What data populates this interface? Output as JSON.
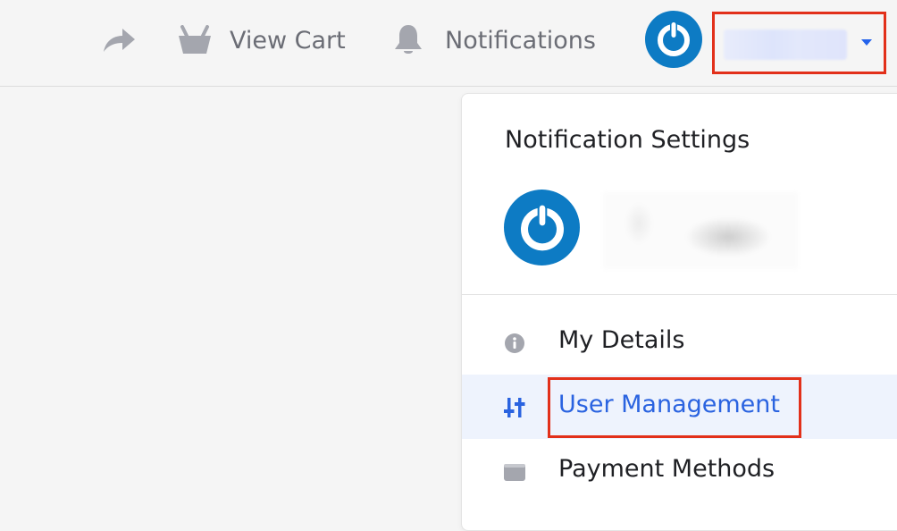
{
  "topbar": {
    "share_icon": "share-arrow-icon",
    "cart_label": "View Cart",
    "cart_icon": "basket-icon",
    "notifications_label": "Notifications",
    "notifications_icon": "bell-icon",
    "logo_icon": "power-logo-icon",
    "account_caret_icon": "caret-down-icon"
  },
  "dropdown": {
    "title": "Notification Settings",
    "items": [
      {
        "label": "My Details",
        "icon": "info-icon"
      },
      {
        "label": "User Management",
        "icon": "sliders-icon",
        "active": true
      },
      {
        "label": "Payment Methods",
        "icon": "card-icon"
      }
    ]
  },
  "colors": {
    "brand_blue": "#0d7bc4",
    "accent": "#2a63e0",
    "highlight_border": "#e2301a",
    "icon_grey": "#a4a6ae"
  }
}
